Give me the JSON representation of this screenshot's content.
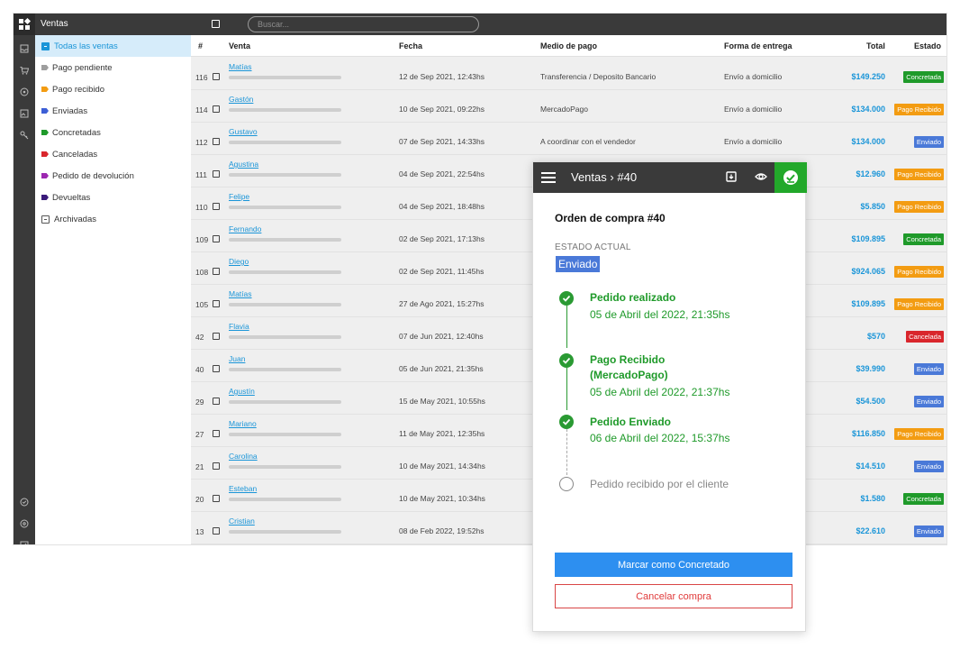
{
  "app": {
    "title": "Ventas"
  },
  "search": {
    "placeholder": "Buscar..."
  },
  "colors": {
    "accent": "#1a95d8",
    "success": "#22a82a",
    "warning": "#f39c12",
    "danger": "#d9262c",
    "info": "#4a79d8"
  },
  "rail_icons": [
    "inbox-icon",
    "cart-icon",
    "tag-icon",
    "image-icon",
    "key-icon",
    "info-icon",
    "help-icon",
    "edit-icon"
  ],
  "sidebar": {
    "items": [
      {
        "label": "Todas las ventas",
        "color": "#1a95d8",
        "icon": "list-icon"
      },
      {
        "label": "Pago pendiente",
        "color": "#9e9e9e",
        "icon": "tag-icon"
      },
      {
        "label": "Pago recibido",
        "color": "#f39c12",
        "icon": "tag-icon"
      },
      {
        "label": "Enviadas",
        "color": "#3d5fd6",
        "icon": "tag-icon"
      },
      {
        "label": "Concretadas",
        "color": "#1f9a2a",
        "icon": "tag-icon"
      },
      {
        "label": "Canceladas",
        "color": "#d9262c",
        "icon": "tag-icon"
      },
      {
        "label": "Pedido de devolución",
        "color": "#9c27b0",
        "icon": "tag-icon"
      },
      {
        "label": "Devueltas",
        "color": "#3a1a7a",
        "icon": "tag-icon"
      },
      {
        "label": "Archivadas",
        "color": "#555555",
        "icon": "archive-icon"
      }
    ]
  },
  "table": {
    "headers": {
      "num": "#",
      "venta": "Venta",
      "fecha": "Fecha",
      "medio": "Medio de pago",
      "forma": "Forma de entrega",
      "total": "Total",
      "estado": "Estado"
    },
    "rows": [
      {
        "num": "116",
        "name": "Matías",
        "fecha": "12 de Sep 2021, 12:43hs",
        "medio": "Transferencia / Deposito Bancario",
        "forma": "Envío a domicilio",
        "total": "$149.250",
        "estado": "Concretada",
        "estado_color": "#1f9a2a"
      },
      {
        "num": "114",
        "name": "Gastón",
        "fecha": "10 de Sep 2021, 09:22hs",
        "medio": "MercadoPago",
        "forma": "Envío a domicilio",
        "total": "$134.000",
        "estado": "Pago Recibido",
        "estado_color": "#f39c12"
      },
      {
        "num": "112",
        "name": "Gustavo",
        "fecha": "07 de Sep 2021, 14:33hs",
        "medio": "A coordinar con el vendedor",
        "forma": "Envío a domicilio",
        "total": "$134.000",
        "estado": "Enviado",
        "estado_color": "#4a79d8"
      },
      {
        "num": "111",
        "name": "Agustina",
        "fecha": "04 de Sep 2021, 22:54hs",
        "medio": "",
        "forma": "",
        "total": "$12.960",
        "estado": "Pago Recibido",
        "estado_color": "#f39c12"
      },
      {
        "num": "110",
        "name": "Felipe",
        "fecha": "04 de Sep 2021, 18:48hs",
        "medio": "",
        "forma": "",
        "total": "$5.850",
        "estado": "Pago Recibido",
        "estado_color": "#f39c12"
      },
      {
        "num": "109",
        "name": "Fernando",
        "fecha": "02 de Sep 2021, 17:13hs",
        "medio": "",
        "forma": "",
        "total": "$109.895",
        "estado": "Concretada",
        "estado_color": "#1f9a2a"
      },
      {
        "num": "108",
        "name": "Diego",
        "fecha": "02 de Sep 2021, 11:45hs",
        "medio": "",
        "forma": "",
        "total": "$924.065",
        "estado": "Pago Recibido",
        "estado_color": "#f39c12"
      },
      {
        "num": "105",
        "name": "Matías",
        "fecha": "27 de Ago 2021, 15:27hs",
        "medio": "",
        "forma": "",
        "total": "$109.895",
        "estado": "Pago Recibido",
        "estado_color": "#f39c12"
      },
      {
        "num": "42",
        "name": "Flavia",
        "fecha": "07 de Jun 2021, 12:40hs",
        "medio": "",
        "forma": "",
        "total": "$570",
        "estado": "Cancelada",
        "estado_color": "#d9262c"
      },
      {
        "num": "40",
        "name": "Juan",
        "fecha": "05 de Jun 2021, 21:35hs",
        "medio": "",
        "forma": "",
        "total": "$39.990",
        "estado": "Enviado",
        "estado_color": "#4a79d8"
      },
      {
        "num": "29",
        "name": "Agustín",
        "fecha": "15 de May 2021, 10:55hs",
        "medio": "",
        "forma": "",
        "total": "$54.500",
        "estado": "Enviado",
        "estado_color": "#4a79d8"
      },
      {
        "num": "27",
        "name": "Mariano",
        "fecha": "11 de May 2021, 12:35hs",
        "medio": "",
        "forma": "",
        "total": "$116.850",
        "estado": "Pago Recibido",
        "estado_color": "#f39c12"
      },
      {
        "num": "21",
        "name": "Carolina",
        "fecha": "10 de May 2021, 14:34hs",
        "medio": "",
        "forma": "",
        "total": "$14.510",
        "estado": "Enviado",
        "estado_color": "#4a79d8"
      },
      {
        "num": "20",
        "name": "Esteban",
        "fecha": "10 de May 2021, 10:34hs",
        "medio": "",
        "forma": "",
        "total": "$1.580",
        "estado": "Concretada",
        "estado_color": "#1f9a2a"
      },
      {
        "num": "13",
        "name": "Cristian",
        "fecha": "08 de Feb 2022, 19:52hs",
        "medio": "",
        "forma": "",
        "total": "$22.610",
        "estado": "Enviado",
        "estado_color": "#4a79d8"
      }
    ]
  },
  "panel": {
    "breadcrumb_root": "Ventas",
    "breadcrumb_sep": "›",
    "breadcrumb_current": "#40",
    "title": "Orden de compra #40",
    "estado_label": "ESTADO ACTUAL",
    "estado_value": "Enviado",
    "timeline": {
      "step1_title": "Pedido realizado",
      "step1_date": "05 de Abril del 2022, 21:35hs",
      "step2_title_a": "Pago Recibido",
      "step2_title_b": "(MercadoPago)",
      "step2_date": "05 de Abril del 2022, 21:37hs",
      "step3_title": "Pedido Enviado",
      "step3_date": "06 de Abril del 2022, 15:37hs",
      "step4_title": "Pedido recibido por el cliente"
    },
    "primary_button": "Marcar como Concretado",
    "cancel_button": "Cancelar compra"
  }
}
